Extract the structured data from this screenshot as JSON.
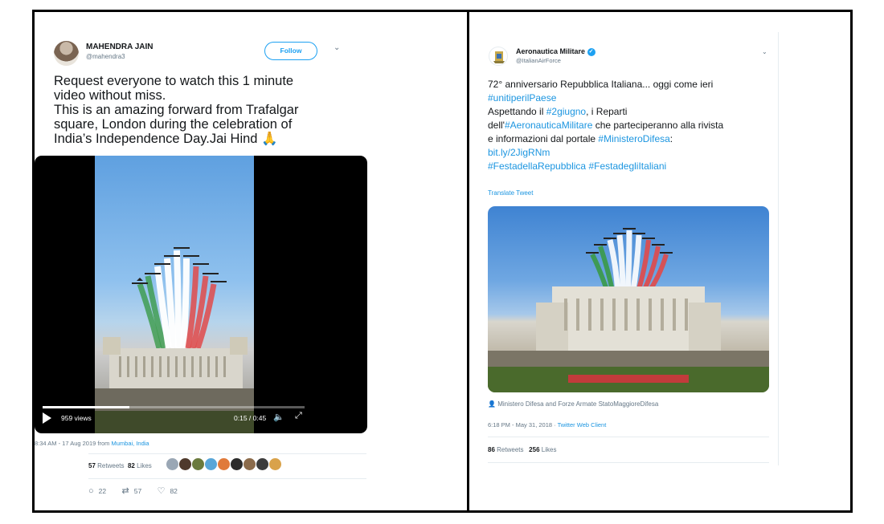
{
  "left_tweet": {
    "author_name": "MAHENDRA JAIN",
    "author_handle": "@mahendra3",
    "follow_label": "Follow",
    "chevron": "⌄",
    "text_lines": [
      "Request everyone to watch this 1 minute",
      "video without miss.",
      "This is an amazing forward from Trafalgar",
      "square, London during the celebration of",
      "India’s Independence Day.Jai Hind 🙏"
    ],
    "video": {
      "views": "959 views",
      "time": "0:15 / 0:45",
      "progress": 0.33
    },
    "timestamp": "8:34 AM - 17 Aug 2019 from ",
    "location": "Mumbai, India",
    "retweets_count": "57",
    "retweets_label": "Retweets",
    "likes_count": "82",
    "likes_label": "Likes",
    "liker_colors": [
      "#9aa7b5",
      "#4f3a2c",
      "#6a7a3d",
      "#58a6d8",
      "#e07a3a",
      "#2b2b2b",
      "#8b6b4b",
      "#3c3c3c",
      "#d9a24a"
    ],
    "reply_count": "22",
    "retweet_action_count": "57",
    "like_action_count": "82"
  },
  "right_tweet": {
    "author_name": "Aeronautica Militare",
    "author_handle": "@ItalianAirForce",
    "chevron": "⌄",
    "text_line1": "72° anniversario Repubblica Italiana... oggi come ieri",
    "hashtag_unitiperil": "#unitiperilPaese",
    "line3_pre": "Aspettando il ",
    "hashtag_2giugno": "#2giugno",
    "line3_post": ", i Reparti",
    "line4_pre": "dell'",
    "hashtag_aeronautica": "#AeronauticaMilitare",
    "line4_post": " che parteciperanno alla rivista",
    "line5_pre": "e informazioni dal portale ",
    "hashtag_ministero": "#MinisteroDifesa",
    "line5_post": ":",
    "link": "bit.ly/2JigRNm",
    "hashtag_festa": "#FestadellaRepubblica",
    "hashtag_italiani": "#FestadegliItaliani",
    "translate_label": "Translate Tweet",
    "photo_caption": "Ministero Difesa and Forze Armate StatoMaggioreDifesa",
    "timestamp": "6:18 PM - May 31, 2018 · ",
    "client": "Twitter Web Client",
    "retweets_count": "86",
    "retweets_label": "Retweets",
    "likes_count": "256",
    "likes_label": "Likes"
  }
}
